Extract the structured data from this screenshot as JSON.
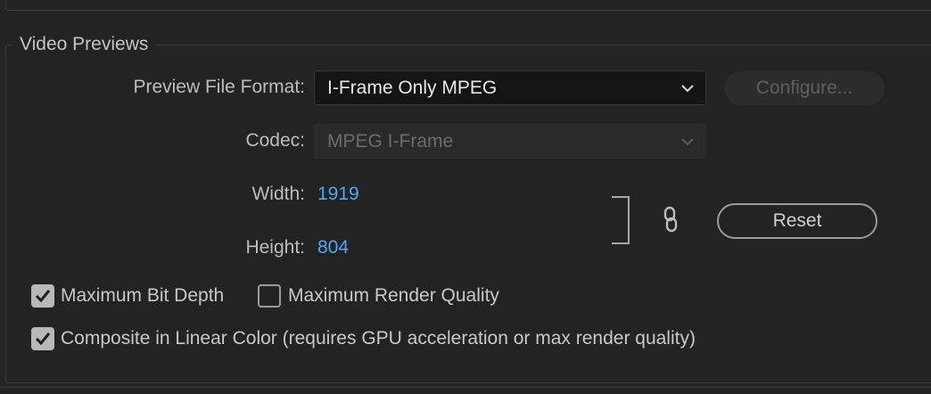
{
  "group": {
    "title": "Video Previews"
  },
  "preview_format": {
    "label": "Preview File Format:",
    "value": "I-Frame Only MPEG",
    "configure_label": "Configure..."
  },
  "codec": {
    "label": "Codec:",
    "value": "MPEG I-Frame"
  },
  "dimensions": {
    "width_label": "Width:",
    "width_value": "1919",
    "height_label": "Height:",
    "height_value": "804",
    "reset_label": "Reset"
  },
  "options": {
    "max_bit_depth": {
      "label": "Maximum Bit Depth",
      "checked": true
    },
    "max_render_quality": {
      "label": "Maximum Render Quality",
      "checked": false
    },
    "composite_linear": {
      "label": "Composite in Linear Color (requires GPU acceleration or max render quality)",
      "checked": true
    }
  },
  "colors": {
    "background": "#232323",
    "link_value": "#4ea7f5",
    "dropdown_bg": "#141414"
  },
  "icons": [
    "chevron-down-icon",
    "link-icon",
    "checkmark-icon"
  ]
}
